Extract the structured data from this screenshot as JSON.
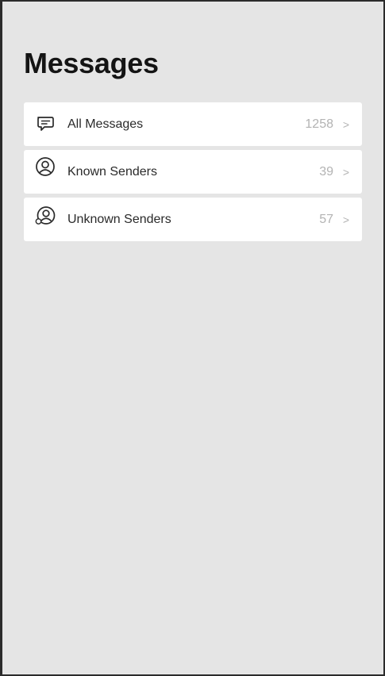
{
  "header": {
    "title": "Messages"
  },
  "list": {
    "items": [
      {
        "label": "All Messages",
        "count": "1258",
        "chevron": ">",
        "icon": "message-bubble-icon"
      },
      {
        "label": "Known Senders",
        "count": "39",
        "chevron": ">",
        "icon": "person-circle-icon"
      },
      {
        "label": "Unknown Senders",
        "count": "57",
        "chevron": ">",
        "icon": "person-circle-question-icon"
      }
    ]
  },
  "colors": {
    "background": "#e5e5e5",
    "card": "#ffffff",
    "title_text": "#141414",
    "secondary_text": "#b3b3b3"
  }
}
